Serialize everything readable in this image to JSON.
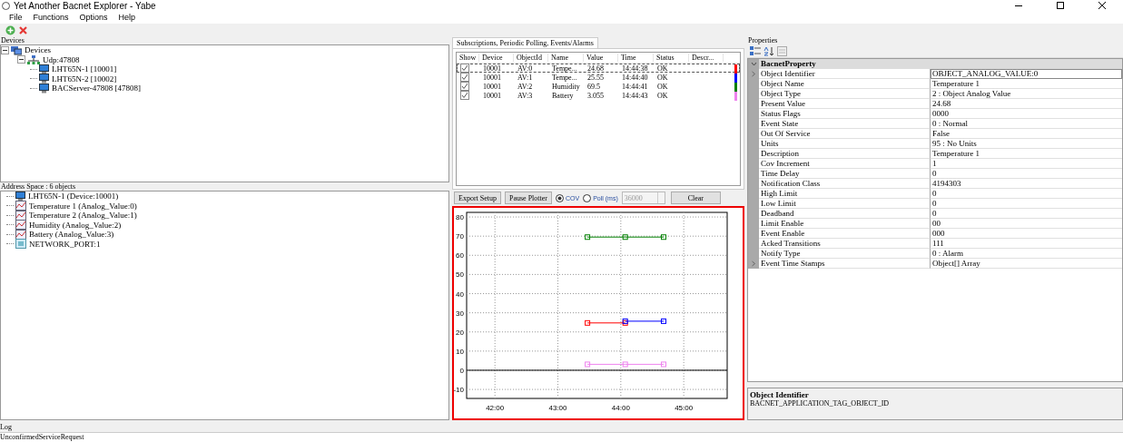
{
  "window": {
    "title": "Yet Another Bacnet Explorer - Yabe"
  },
  "menu": [
    "File",
    "Functions",
    "Options",
    "Help"
  ],
  "devices": {
    "label": "Devices",
    "tree": [
      {
        "label": "Devices",
        "kind": "root",
        "expanded": true,
        "children": [
          {
            "label": "Udp:47808",
            "kind": "network",
            "expanded": true,
            "children": [
              {
                "label": "LHT65N-1 [10001]",
                "kind": "device"
              },
              {
                "label": "LHT65N-2 [10002]",
                "kind": "device"
              },
              {
                "label": "BACServer-47808 [47808]",
                "kind": "device"
              }
            ]
          }
        ]
      }
    ]
  },
  "address_space": {
    "label": "Address Space : 6 objects",
    "items": [
      {
        "label": "LHT65N-1 (Device:10001)",
        "kind": "device"
      },
      {
        "label": "Temperature 1 (Analog_Value:0)",
        "kind": "analog"
      },
      {
        "label": "Temperature 2 (Analog_Value:1)",
        "kind": "analog"
      },
      {
        "label": "Humidity (Analog_Value:2)",
        "kind": "analog"
      },
      {
        "label": "Battery (Analog_Value:3)",
        "kind": "analog"
      },
      {
        "label": "NETWORK_PORT:1",
        "kind": "port"
      }
    ]
  },
  "subscriptions": {
    "tab": "Subscriptions, Periodic Polling, Events/Alarms",
    "columns": [
      "Show",
      "Device",
      "ObjectId",
      "Name",
      "Value",
      "Time",
      "Status",
      "Descr..."
    ],
    "rows": [
      {
        "checked": true,
        "selected": true,
        "device": "10001",
        "object_id": "AV:0",
        "name": "Tempe...",
        "value": "24.68",
        "time": "14:44:38",
        "status": "OK",
        "color": "#ff0000"
      },
      {
        "checked": true,
        "selected": false,
        "device": "10001",
        "object_id": "AV:1",
        "name": "Tempe...",
        "value": "25.55",
        "time": "14:44:40",
        "status": "OK",
        "color": "#0000ff"
      },
      {
        "checked": true,
        "selected": false,
        "device": "10001",
        "object_id": "AV:2",
        "name": "Humidity",
        "value": "69.5",
        "time": "14:44:41",
        "status": "OK",
        "color": "#008000"
      },
      {
        "checked": true,
        "selected": false,
        "device": "10001",
        "object_id": "AV:3",
        "name": "Battery",
        "value": "3.055",
        "time": "14:44:43",
        "status": "OK",
        "color": "#ee82ee"
      }
    ]
  },
  "plot_controls": {
    "export_button": "Export Setup",
    "pause_button": "Pause Plotter",
    "modes": [
      {
        "label": "COV",
        "selected": true
      },
      {
        "label": "Poll (ms)",
        "selected": false
      }
    ],
    "poll_interval": "36000",
    "clear_button": "Clear"
  },
  "chart": {
    "chart_data": {
      "type": "line",
      "x": [
        43.47,
        44.07,
        44.68
      ],
      "xlim": [
        41.55,
        45.69
      ],
      "ylim": [
        -14.7,
        82.4
      ],
      "xticks": [
        {
          "value": 42,
          "label": "42:00"
        },
        {
          "value": 43,
          "label": "43:00"
        },
        {
          "value": 44,
          "label": "44:00"
        },
        {
          "value": 45,
          "label": "45:00"
        }
      ],
      "yticks": [
        -10,
        0,
        10,
        20,
        30,
        40,
        50,
        60,
        70,
        80
      ],
      "grid": true,
      "series": [
        {
          "color": "#ff0000",
          "marker": "square",
          "values": [
            24.7,
            24.7,
            null
          ]
        },
        {
          "color": "#0000ff",
          "marker": "square",
          "values": [
            null,
            25.6,
            25.6
          ]
        },
        {
          "color": "#008000",
          "marker": "square",
          "values": [
            69.5,
            69.5,
            69.5
          ]
        },
        {
          "color": "#ee82ee",
          "marker": "square",
          "values": [
            3.1,
            3.1,
            3.1
          ]
        }
      ]
    }
  },
  "properties": {
    "label": "Properties",
    "category": "BacnetProperty",
    "expanded": true,
    "rows": [
      {
        "name": "Object Identifier",
        "value": "OBJECT_ANALOG_VALUE:0",
        "expandable": true,
        "selected": true
      },
      {
        "name": "Object Name",
        "value": "Temperature 1",
        "expandable": false,
        "selected": false
      },
      {
        "name": "Object Type",
        "value": "2 : Object Analog Value",
        "expandable": false,
        "selected": false
      },
      {
        "name": "Present Value",
        "value": "24.68",
        "expandable": false,
        "selected": false
      },
      {
        "name": "Status Flags",
        "value": "0000",
        "expandable": false,
        "selected": false
      },
      {
        "name": "Event State",
        "value": "0 : Normal",
        "expandable": false,
        "selected": false
      },
      {
        "name": "Out Of Service",
        "value": "False",
        "expandable": false,
        "selected": false
      },
      {
        "name": "Units",
        "value": "95 : No Units",
        "expandable": false,
        "selected": false
      },
      {
        "name": "Description",
        "value": "Temperature 1",
        "expandable": false,
        "selected": false
      },
      {
        "name": "Cov Increment",
        "value": "1",
        "expandable": false,
        "selected": false
      },
      {
        "name": "Time Delay",
        "value": "0",
        "expandable": false,
        "selected": false
      },
      {
        "name": "Notification Class",
        "value": "4194303",
        "expandable": false,
        "selected": false
      },
      {
        "name": "High Limit",
        "value": "0",
        "expandable": false,
        "selected": false
      },
      {
        "name": "Low Limit",
        "value": "0",
        "expandable": false,
        "selected": false
      },
      {
        "name": "Deadband",
        "value": "0",
        "expandable": false,
        "selected": false
      },
      {
        "name": "Limit Enable",
        "value": "00",
        "expandable": false,
        "selected": false
      },
      {
        "name": "Event Enable",
        "value": "000",
        "expandable": false,
        "selected": false
      },
      {
        "name": "Acked Transitions",
        "value": "111",
        "expandable": false,
        "selected": false
      },
      {
        "name": "Notify Type",
        "value": "0 : Alarm",
        "expandable": false,
        "selected": false
      },
      {
        "name": "Event Time Stamps",
        "value": "Object[] Array",
        "expandable": true,
        "selected": false
      }
    ],
    "description_title": "Object Identifier",
    "description_text": "BACNET_APPLICATION_TAG_OBJECT_ID"
  },
  "log": {
    "label": "Log",
    "lines": [
      "UnconfirmedServiceRequest"
    ]
  }
}
